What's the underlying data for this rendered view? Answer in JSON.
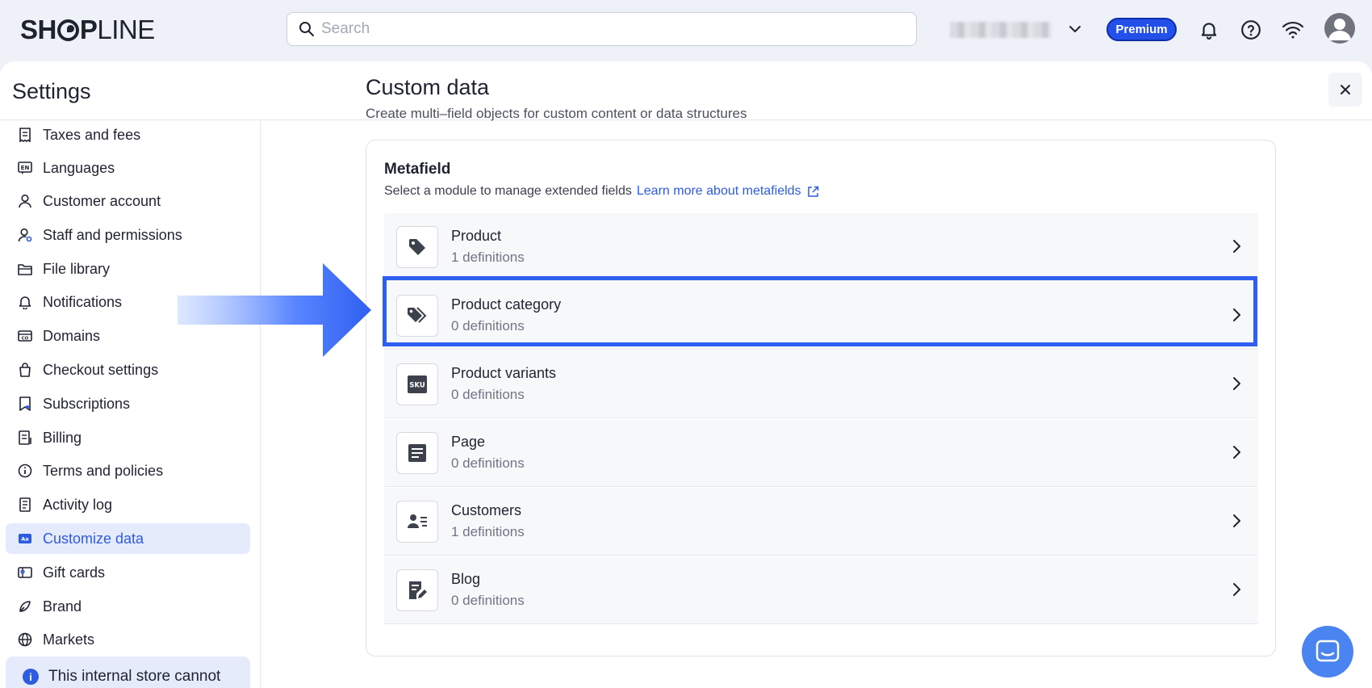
{
  "header": {
    "logo_bold": "SH",
    "logo_bold2": "P",
    "logo_thin": "LINE",
    "search_placeholder": "Search",
    "plan_badge": "Premium"
  },
  "settings": {
    "title": "Settings"
  },
  "sidebar": {
    "items": [
      {
        "label": "Taxes and fees",
        "icon": "receipt-icon"
      },
      {
        "label": "Languages",
        "icon": "language-icon"
      },
      {
        "label": "Customer account",
        "icon": "person-icon"
      },
      {
        "label": "Staff and permissions",
        "icon": "staff-icon"
      },
      {
        "label": "File library",
        "icon": "folder-icon"
      },
      {
        "label": "Notifications",
        "icon": "bell-icon"
      },
      {
        "label": "Domains",
        "icon": "domain-icon"
      },
      {
        "label": "Checkout settings",
        "icon": "bag-icon"
      },
      {
        "label": "Subscriptions",
        "icon": "subscription-icon"
      },
      {
        "label": "Billing",
        "icon": "billing-icon"
      },
      {
        "label": "Terms and policies",
        "icon": "info-icon"
      },
      {
        "label": "Activity log",
        "icon": "log-icon"
      },
      {
        "label": "Customize data",
        "icon": "custom-data-icon",
        "active": true
      },
      {
        "label": "Gift cards",
        "icon": "gift-card-icon"
      },
      {
        "label": "Brand",
        "icon": "brand-icon"
      },
      {
        "label": "Markets",
        "icon": "globe-icon"
      }
    ],
    "notice": "This internal store cannot"
  },
  "content": {
    "title": "Custom data",
    "subtitle": "Create multi–field objects for custom content or data structures",
    "card": {
      "title": "Metafield",
      "description": "Select a module to manage extended fields",
      "link": "Learn more about metafields",
      "rows": [
        {
          "name": "Product",
          "definitions": "1 definitions",
          "icon": "tag-icon"
        },
        {
          "name": "Product category",
          "definitions": "0 definitions",
          "icon": "tags-icon"
        },
        {
          "name": "Product variants",
          "definitions": "0 definitions",
          "icon": "sku-icon",
          "icon_text": "SKU"
        },
        {
          "name": "Page",
          "definitions": "0 definitions",
          "icon": "page-icon"
        },
        {
          "name": "Customers",
          "definitions": "1 definitions",
          "icon": "customer-card-icon"
        },
        {
          "name": "Blog",
          "definitions": "0 definitions",
          "icon": "blog-edit-icon"
        }
      ]
    }
  },
  "colors": {
    "accent": "#2e5ce0",
    "premium": "#2350e8",
    "highlight": "#2f5ff0",
    "chat": "#4a84f0"
  }
}
